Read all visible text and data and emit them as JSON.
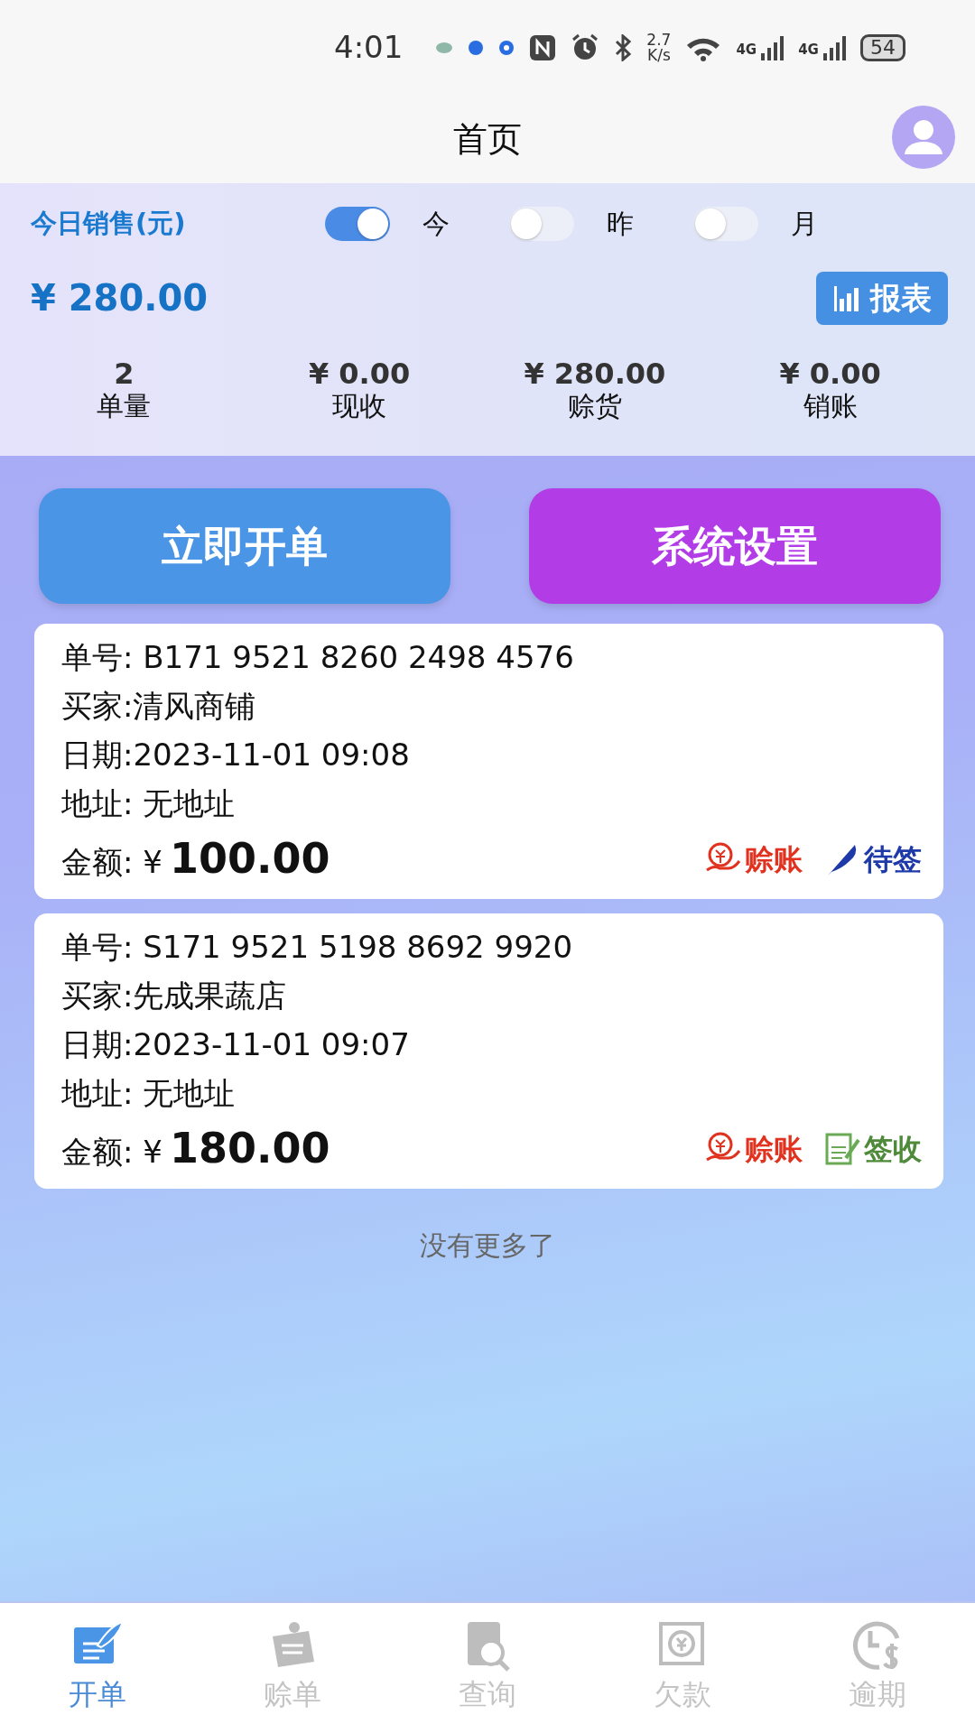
{
  "status_bar": {
    "time": "4:01",
    "speed_value": "2.7",
    "speed_unit": "K/s",
    "networks": [
      "4G",
      "4G"
    ],
    "battery": "54"
  },
  "header": {
    "title": "首页"
  },
  "summary": {
    "title": "今日销售(元)",
    "toggles": [
      {
        "label": "今",
        "on": true
      },
      {
        "label": "昨",
        "on": false
      },
      {
        "label": "月",
        "on": false
      }
    ],
    "total": "¥ 280.00",
    "report_button": "报表",
    "stats": [
      {
        "value": "2",
        "label": "单量"
      },
      {
        "value": "¥ 0.00",
        "label": "现收"
      },
      {
        "value": "¥ 280.00",
        "label": "赊货"
      },
      {
        "value": "¥ 0.00",
        "label": "销账"
      }
    ]
  },
  "actions": [
    {
      "label": "立即开单",
      "color": "#4a95e6"
    },
    {
      "label": "系统设置",
      "color": "#b23ce6"
    }
  ],
  "orders": [
    {
      "number": "单号:  B171 9521 8260 2498 4576",
      "buyer": "买家:清风商铺",
      "date": "日期:2023-11-01 09:08",
      "address": "地址: 无地址",
      "amount_label": "金额: ¥",
      "amount": "100.00",
      "tags": [
        {
          "kind": "credit",
          "label": "赊账"
        },
        {
          "kind": "pending",
          "label": "待签"
        }
      ]
    },
    {
      "number": "单号:  S171 9521 5198 8692 9920",
      "buyer": "买家:先成果蔬店",
      "date": "日期:2023-11-01 09:07",
      "address": "地址: 无地址",
      "amount_label": "金额: ¥",
      "amount": "180.00",
      "tags": [
        {
          "kind": "credit",
          "label": "赊账"
        },
        {
          "kind": "signed",
          "label": "签收"
        }
      ]
    }
  ],
  "end_note": "没有更多了",
  "tabs": [
    {
      "label": "开单",
      "selected": true
    },
    {
      "label": "赊单",
      "selected": false
    },
    {
      "label": "查询",
      "selected": false
    },
    {
      "label": "欠款",
      "selected": false
    },
    {
      "label": "逾期",
      "selected": false
    }
  ]
}
